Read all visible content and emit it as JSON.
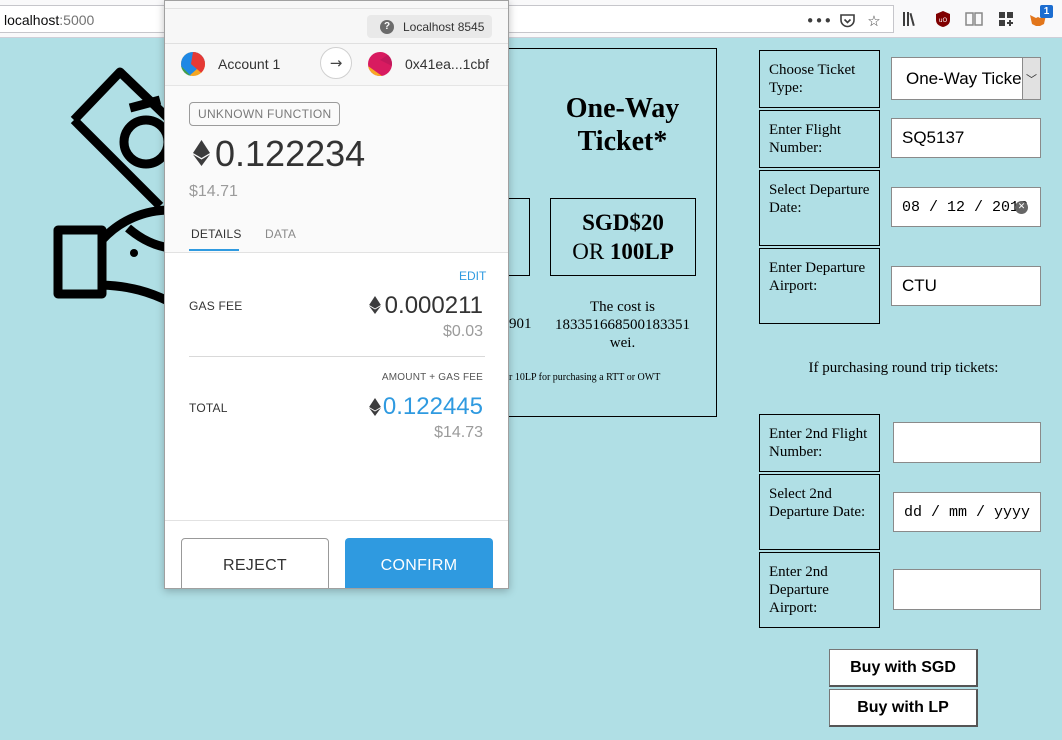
{
  "browser": {
    "url_host": "localhost",
    "url_port": ":5000",
    "icons": [
      "more-dots-icon",
      "pocket-icon",
      "bookmark-star-icon",
      "library-icon",
      "ublock-icon",
      "reader-icon",
      "extensions-grid-icon",
      "metamask-fox-icon"
    ],
    "ext_badge": "1"
  },
  "metamask": {
    "network": "Localhost 8545",
    "from_account": "Account 1",
    "to_address": "0x41ea...1cbf",
    "function_badge": "UNKNOWN FUNCTION",
    "eth_amount": "0.122234",
    "fiat_amount": "$14.71",
    "tabs": [
      "DETAILS",
      "DATA"
    ],
    "edit_label": "EDIT",
    "gas_fee_label": "GAS FEE",
    "gas_fee_eth": "0.000211",
    "gas_fee_fiat": "$0.03",
    "amount_gas_label": "AMOUNT + GAS FEE",
    "total_label": "TOTAL",
    "total_eth": "0.122445",
    "total_fiat": "$14.73",
    "reject_label": "REJECT",
    "confirm_label": "CONFIRM",
    "accent_color": "#2f9ae0"
  },
  "ticket_info": {
    "title": "One-Way Ticket*",
    "price_sgd": "SGD$20",
    "price_or": "OR ",
    "price_lp": "100LP",
    "left_fragment": "901",
    "cost_text": "The cost is 183351668500183351 wei.",
    "note": "r 10LP for purchasing a RTT or OWT"
  },
  "form": {
    "ticket_type_label": "Choose Ticket Type:",
    "ticket_type_value": "One-Way Ticke",
    "flight_label": "Enter Flight Number:",
    "flight_value": "SQ5137",
    "date_label": "Select Departure Date:",
    "date_value": "08 / 12 / 2018",
    "airport_label": "Enter Departure Airport:",
    "airport_value": "CTU",
    "round_trip_note": "If purchasing round trip tickets:",
    "flight2_label": "Enter 2nd Flight Number:",
    "flight2_value": "",
    "date2_label": "Select 2nd Departure Date:",
    "date2_placeholder": "dd / mm / yyyy",
    "airport2_label": "Enter 2nd Departure Airport:",
    "airport2_value": "",
    "buy_sgd": "Buy with SGD",
    "buy_lp": "Buy with LP"
  }
}
